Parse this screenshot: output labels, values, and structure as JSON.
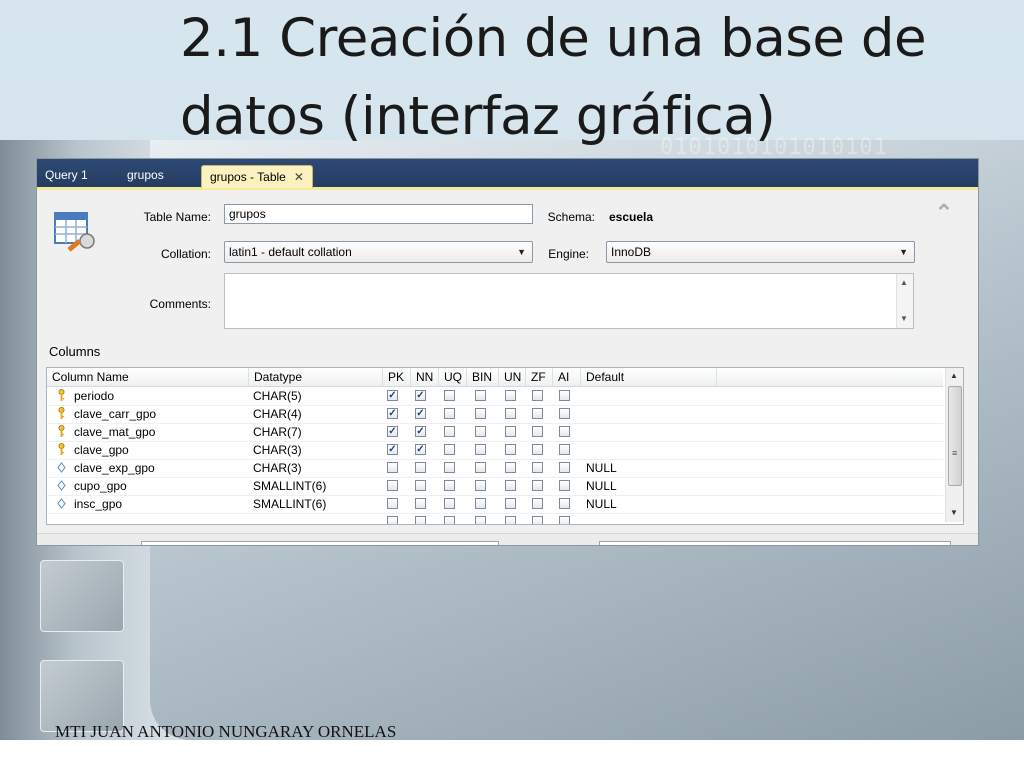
{
  "slide": {
    "title": "2.1 Creación de una base de datos (interfaz gráfica)",
    "footer": "MTI JUAN ANTONIO NUNGARAY ORNELAS"
  },
  "tabs": [
    {
      "label": "Query 1",
      "active": false
    },
    {
      "label": "grupos",
      "active": false
    },
    {
      "label": "grupos - Table",
      "active": true,
      "close": "✕"
    }
  ],
  "form": {
    "table_name_label": "Table Name:",
    "table_name_value": "grupos",
    "schema_label": "Schema:",
    "schema_value": "escuela",
    "collation_label": "Collation:",
    "collation_value": "latin1 - default collation",
    "engine_label": "Engine:",
    "engine_value": "InnoDB",
    "comments_label": "Comments:",
    "comments_value": ""
  },
  "columns": {
    "section_title": "Columns",
    "headers": [
      "Column Name",
      "Datatype",
      "PK",
      "NN",
      "UQ",
      "BIN",
      "UN",
      "ZF",
      "AI",
      "Default"
    ],
    "rows": [
      {
        "icon": "primary-key-icon",
        "name": "periodo",
        "datatype": "CHAR(5)",
        "pk": true,
        "nn": true,
        "uq": false,
        "bin": false,
        "un": false,
        "zf": false,
        "ai": false,
        "default": ""
      },
      {
        "icon": "primary-key-icon",
        "name": "clave_carr_gpo",
        "datatype": "CHAR(4)",
        "pk": true,
        "nn": true,
        "uq": false,
        "bin": false,
        "un": false,
        "zf": false,
        "ai": false,
        "default": ""
      },
      {
        "icon": "primary-key-icon",
        "name": "clave_mat_gpo",
        "datatype": "CHAR(7)",
        "pk": true,
        "nn": true,
        "uq": false,
        "bin": false,
        "un": false,
        "zf": false,
        "ai": false,
        "default": ""
      },
      {
        "icon": "primary-key-icon",
        "name": "clave_gpo",
        "datatype": "CHAR(3)",
        "pk": true,
        "nn": true,
        "uq": false,
        "bin": false,
        "un": false,
        "zf": false,
        "ai": false,
        "default": ""
      },
      {
        "icon": "column-diamond-icon",
        "name": "clave_exp_gpo",
        "datatype": "CHAR(3)",
        "pk": false,
        "nn": false,
        "uq": false,
        "bin": false,
        "un": false,
        "zf": false,
        "ai": false,
        "default": "NULL"
      },
      {
        "icon": "column-diamond-icon",
        "name": "cupo_gpo",
        "datatype": "SMALLINT(6)",
        "pk": false,
        "nn": false,
        "uq": false,
        "bin": false,
        "un": false,
        "zf": false,
        "ai": false,
        "default": "NULL"
      },
      {
        "icon": "column-diamond-icon",
        "name": "insc_gpo",
        "datatype": "SMALLINT(6)",
        "pk": false,
        "nn": false,
        "uq": false,
        "bin": false,
        "un": false,
        "zf": false,
        "ai": false,
        "default": "NULL"
      }
    ]
  },
  "colors": {
    "tabbar": "#2e4a74",
    "active_tab": "#fbf2c0",
    "check": "#1d3f8a"
  }
}
